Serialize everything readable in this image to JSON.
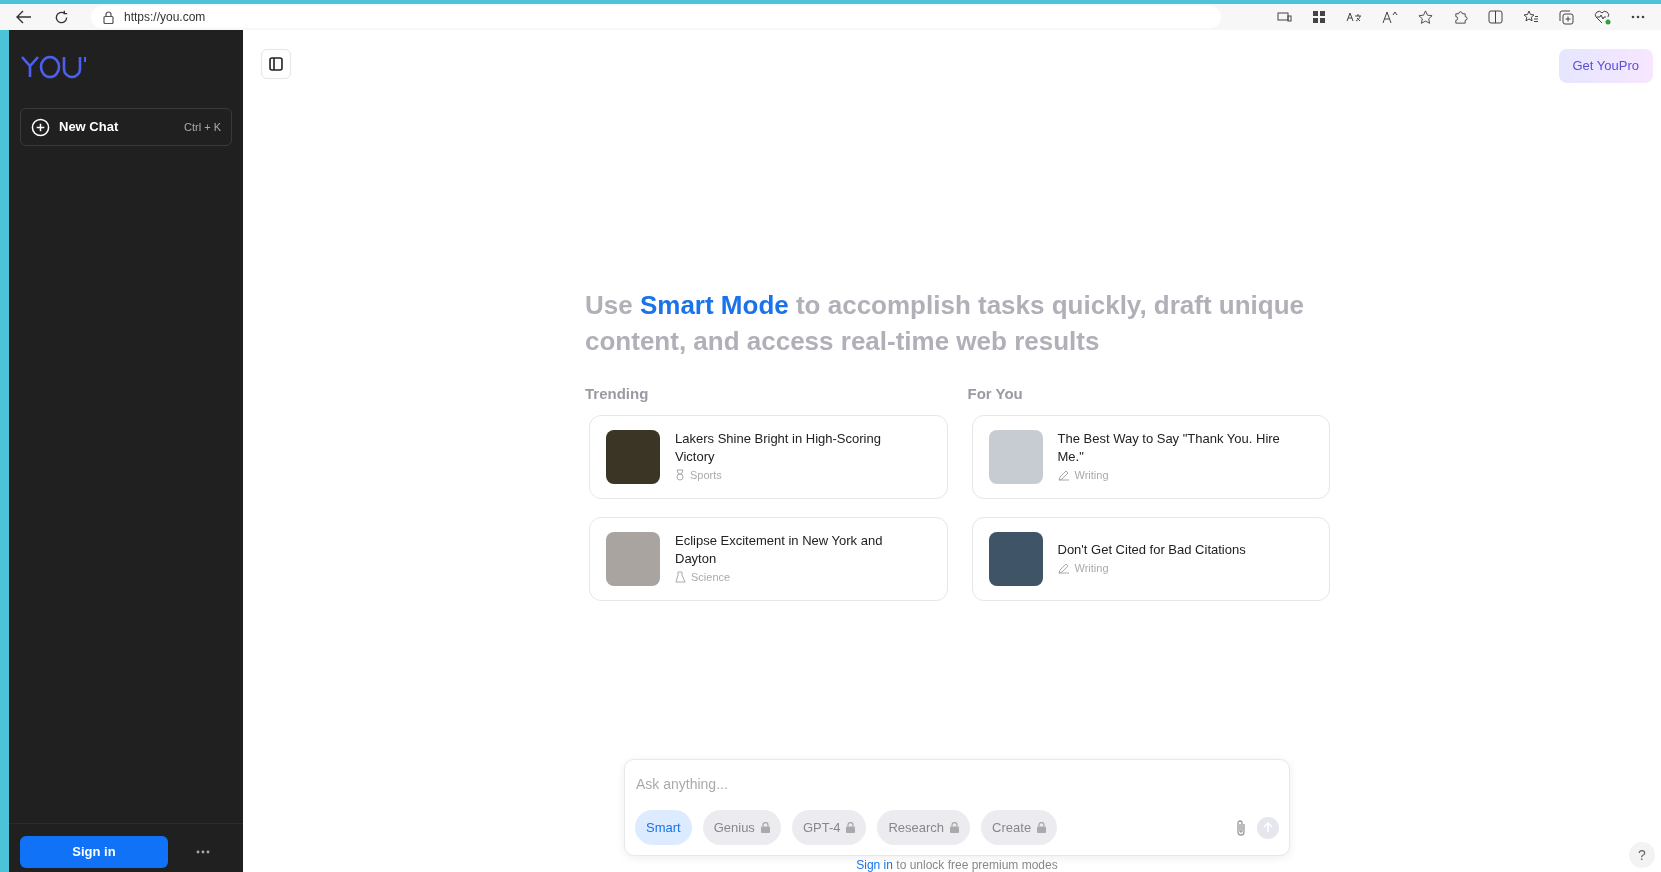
{
  "browser": {
    "url": "https://you.com"
  },
  "sidebar": {
    "new_chat": {
      "label": "New Chat",
      "shortcut": "Ctrl + K"
    },
    "sign_in": "Sign in"
  },
  "header": {
    "upgrade_button": "Get YouPro"
  },
  "headline": {
    "before": "Use ",
    "highlight": "Smart Mode",
    "after": " to accomplish tasks quickly, draft unique content, and access real-time web results"
  },
  "sections": [
    {
      "title": "Trending",
      "cards": [
        {
          "title": "Lakers Shine Bright in High-Scoring Victory",
          "category": "Sports",
          "kind": "sports"
        },
        {
          "title": "Eclipse Excitement in New York and Dayton",
          "category": "Science",
          "kind": "science"
        }
      ]
    },
    {
      "title": "For You",
      "cards": [
        {
          "title": "The Best Way to Say \"Thank You. Hire Me.\"",
          "category": "Writing",
          "kind": "writing"
        },
        {
          "title": "Don't Get Cited for Bad Citations",
          "category": "Writing",
          "kind": "writing"
        }
      ]
    }
  ],
  "composer": {
    "placeholder": "Ask anything...",
    "modes": [
      {
        "label": "Smart",
        "selected": true,
        "locked": false
      },
      {
        "label": "Genius",
        "selected": false,
        "locked": true
      },
      {
        "label": "GPT-4",
        "selected": false,
        "locked": true
      },
      {
        "label": "Research",
        "selected": false,
        "locked": true
      },
      {
        "label": "Create",
        "selected": false,
        "locked": true
      }
    ]
  },
  "footer_note": {
    "link": "Sign in",
    "text": " to unlock free premium modes"
  },
  "help_button": "?"
}
